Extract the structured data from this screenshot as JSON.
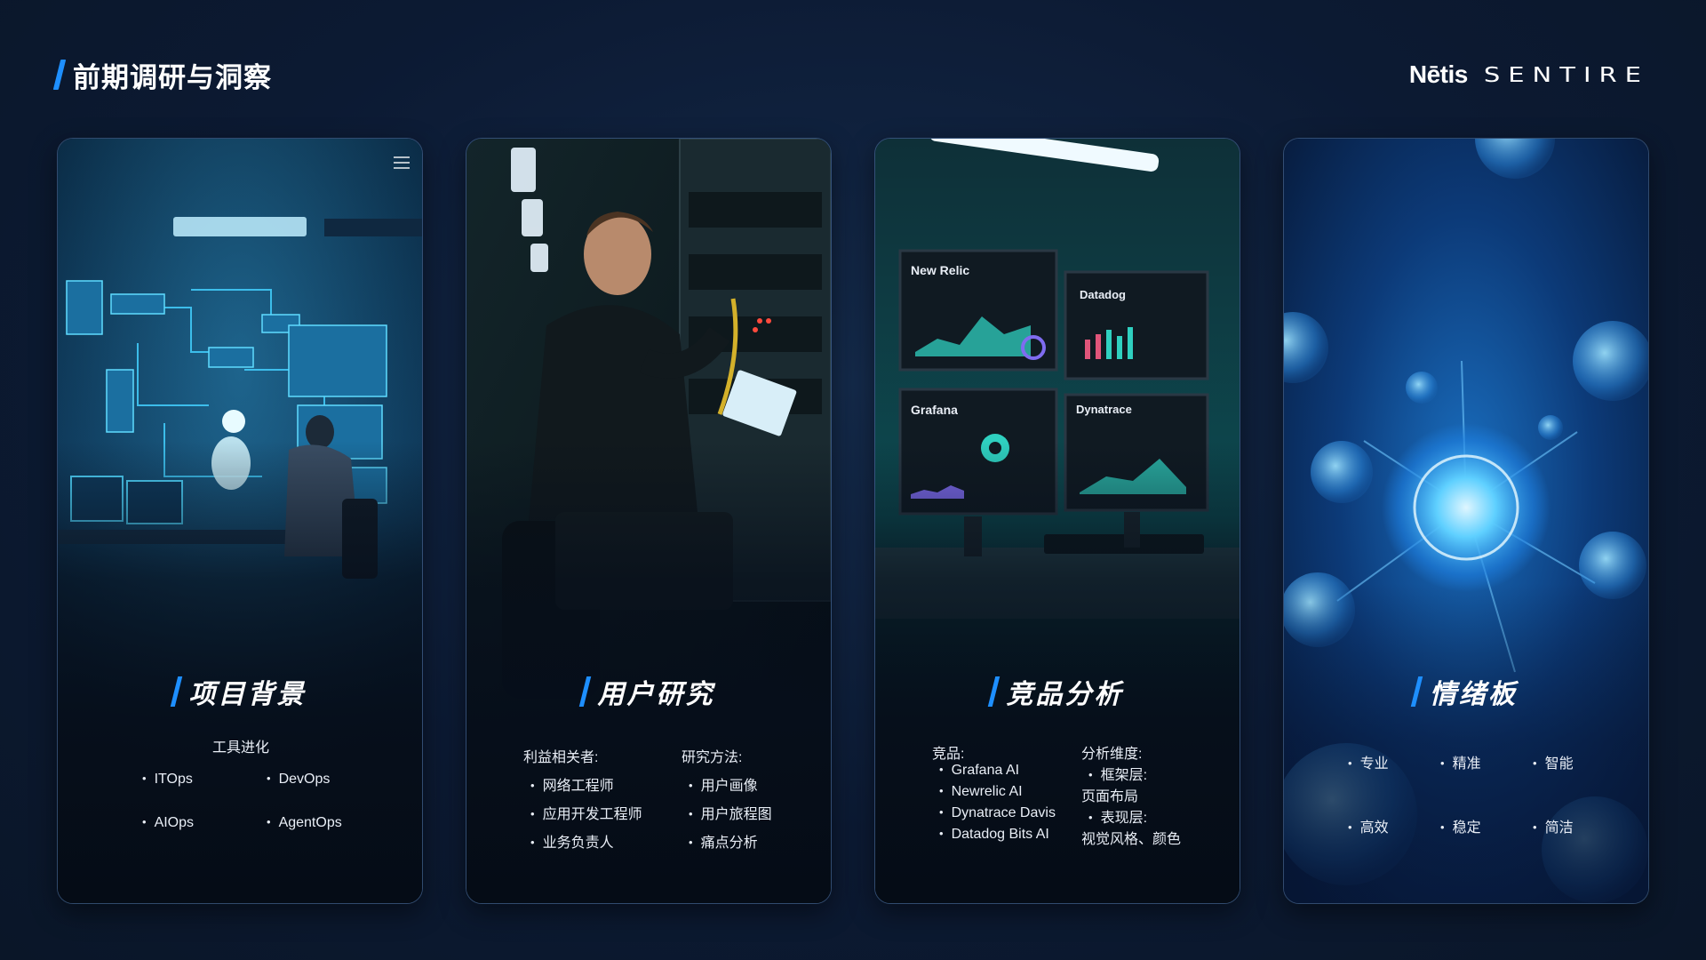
{
  "page": {
    "title": "前期调研与洞察"
  },
  "logo": {
    "brand": "Nētis",
    "product": "SENTIRE"
  },
  "cards": [
    {
      "title": "项目背景",
      "subtitle": "工具进化",
      "items": [
        "ITOps",
        "DevOps",
        "AIOps",
        "AgentOps"
      ]
    },
    {
      "title": "用户研究",
      "col1_label": "利益相关者:",
      "col1_items": [
        "网络工程师",
        "应用开发工程师",
        "业务负责人"
      ],
      "col2_label": "研究方法:",
      "col2_items": [
        "用户画像",
        "用户旅程图",
        "痛点分析"
      ]
    },
    {
      "title": "竞品分析",
      "col1_label": "竞品:",
      "col1_items": [
        "Grafana AI",
        "Newrelic AI",
        "Dynatrace Davis",
        "Datadog Bits AI"
      ],
      "col2_label": "分析维度:",
      "col2_lines": [
        "框架层:",
        "页面布局",
        "表现层:",
        "视觉风格、颜色"
      ],
      "monitor_labels": [
        "New Relic",
        "Datadog",
        "Grafana",
        "Dynatrace"
      ]
    },
    {
      "title": "情绪板",
      "items": [
        "专业",
        "精准",
        "智能",
        "高效",
        "稳定",
        "简洁"
      ]
    }
  ],
  "colors": {
    "accent": "#1e8fff",
    "background": "#0c1a33"
  }
}
